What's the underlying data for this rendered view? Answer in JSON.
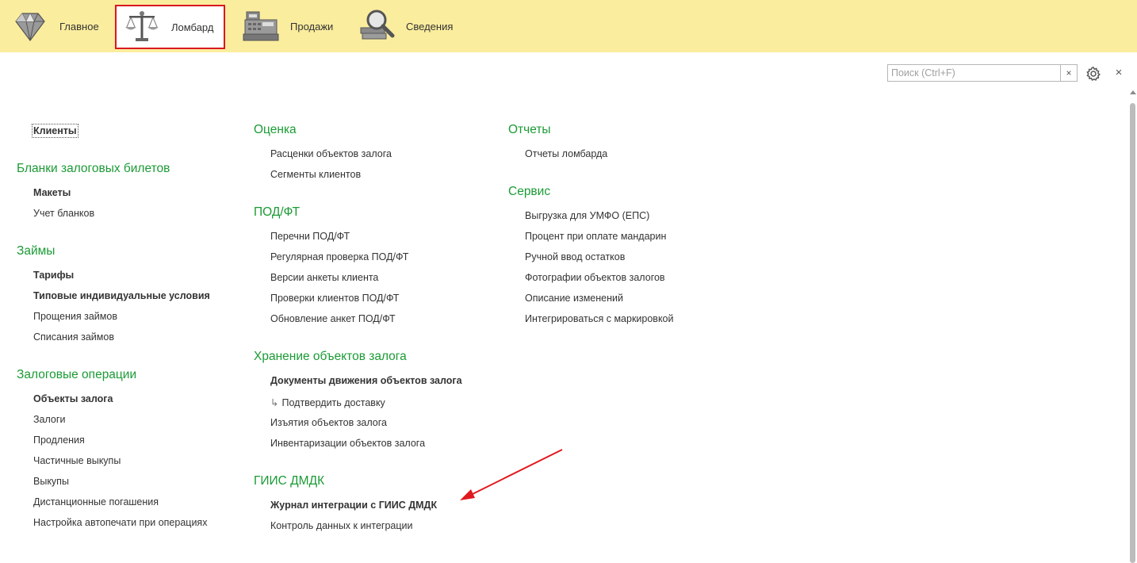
{
  "sections": [
    {
      "label": "Главное",
      "icon": "diamond-icon"
    },
    {
      "label": "Ломбард",
      "icon": "scales-icon",
      "active": true
    },
    {
      "label": "Продажи",
      "icon": "cash-register-icon"
    },
    {
      "label": "Сведения",
      "icon": "magnifier-icon"
    }
  ],
  "search": {
    "placeholder": "Поиск (Ctrl+F)",
    "value": "",
    "clear_icon": "×"
  },
  "toolbar": {
    "settings_icon": "gear-icon",
    "close_icon": "×"
  },
  "columns": {
    "col1": {
      "top_item": "Клиенты",
      "groups": [
        {
          "title": "Бланки залоговых билетов",
          "items": [
            "Макеты",
            "Учет бланков"
          ]
        },
        {
          "title": "Займы",
          "items": [
            "Тарифы",
            "Типовые индивидуальные условия",
            "Прощения займов",
            "Списания займов"
          ]
        },
        {
          "title": "Залоговые операции",
          "items": [
            "Объекты залога",
            "Залоги",
            "Продления",
            "Частичные выкупы",
            "Выкупы",
            "Дистанционные погашения",
            "Настройка автопечати при операциях"
          ]
        }
      ]
    },
    "col2": {
      "groups": [
        {
          "title": "Оценка",
          "items": [
            "Расценки объектов залога",
            "Сегменты клиентов"
          ]
        },
        {
          "title": "ПОД/ФТ",
          "items": [
            "Перечни ПОД/ФТ",
            "Регулярная проверка ПОД/ФТ",
            "Версии анкеты клиента",
            "Проверки клиентов ПОД/ФТ",
            "Обновление анкет ПОД/ФТ"
          ]
        },
        {
          "title": "Хранение объектов залога",
          "items": [
            "Документы движения объектов залога",
            "Подтвердить доставку",
            "Изъятия объектов залога",
            "Инвентаризации объектов залога"
          ]
        },
        {
          "title": "ГИИС ДМДК",
          "items": [
            "Журнал интеграции с ГИИС ДМДК",
            "Контроль данных к интеграции"
          ]
        }
      ]
    },
    "col3": {
      "groups": [
        {
          "title": "Отчеты",
          "items": [
            "Отчеты ломбарда"
          ]
        },
        {
          "title": "Сервис",
          "items": [
            "Выгрузка для УМФО (ЕПС)",
            "Процент при оплате мандарин",
            "Ручной ввод остатков",
            "Фотографии объектов залогов",
            "Описание изменений",
            "Интегрироваться с маркировкой"
          ]
        }
      ]
    }
  },
  "colors": {
    "topbar": "#fbed9e",
    "group_title": "#1b9b35",
    "active_border": "#d9181f",
    "arrow": "#e0191f"
  }
}
